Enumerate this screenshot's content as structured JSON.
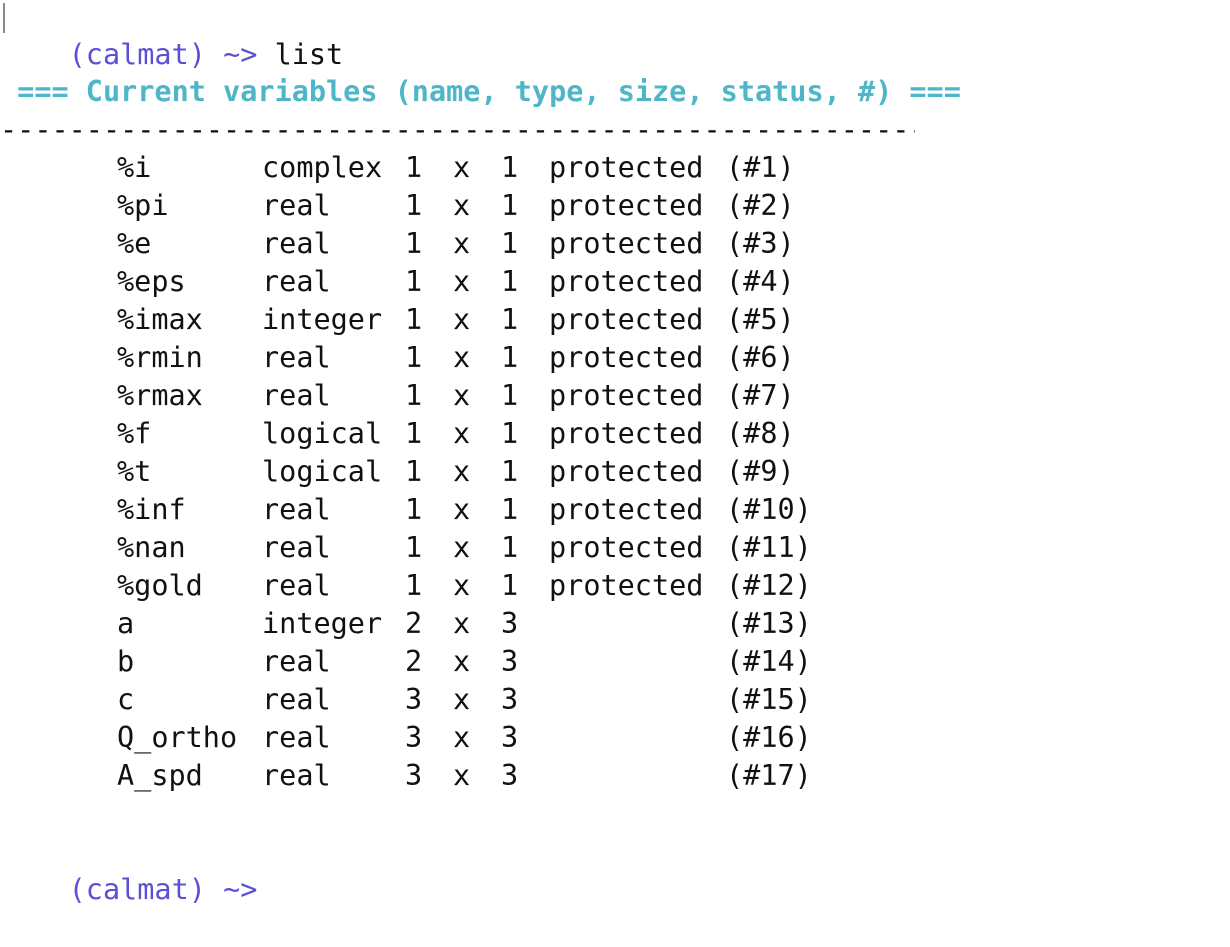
{
  "terminal": {
    "prompt": "(calmat) ~>",
    "command": "list",
    "header": " === Current variables (name, type, size, status, #) ===",
    "separator": "----------------------------------------------------------",
    "size_sep": "x",
    "final_prompt": "(calmat) ~>"
  },
  "variables": [
    {
      "name": "%i",
      "type": "complex",
      "rows": "1",
      "cols": "1",
      "status": "protected",
      "index": "(#1)"
    },
    {
      "name": "%pi",
      "type": "real",
      "rows": "1",
      "cols": "1",
      "status": "protected",
      "index": "(#2)"
    },
    {
      "name": "%e",
      "type": "real",
      "rows": "1",
      "cols": "1",
      "status": "protected",
      "index": "(#3)"
    },
    {
      "name": "%eps",
      "type": "real",
      "rows": "1",
      "cols": "1",
      "status": "protected",
      "index": "(#4)"
    },
    {
      "name": "%imax",
      "type": "integer",
      "rows": "1",
      "cols": "1",
      "status": "protected",
      "index": "(#5)"
    },
    {
      "name": "%rmin",
      "type": "real",
      "rows": "1",
      "cols": "1",
      "status": "protected",
      "index": "(#6)"
    },
    {
      "name": "%rmax",
      "type": "real",
      "rows": "1",
      "cols": "1",
      "status": "protected",
      "index": "(#7)"
    },
    {
      "name": "%f",
      "type": "logical",
      "rows": "1",
      "cols": "1",
      "status": "protected",
      "index": "(#8)"
    },
    {
      "name": "%t",
      "type": "logical",
      "rows": "1",
      "cols": "1",
      "status": "protected",
      "index": "(#9)"
    },
    {
      "name": "%inf",
      "type": "real",
      "rows": "1",
      "cols": "1",
      "status": "protected",
      "index": "(#10)"
    },
    {
      "name": "%nan",
      "type": "real",
      "rows": "1",
      "cols": "1",
      "status": "protected",
      "index": "(#11)"
    },
    {
      "name": "%gold",
      "type": "real",
      "rows": "1",
      "cols": "1",
      "status": "protected",
      "index": "(#12)"
    },
    {
      "name": "a",
      "type": "integer",
      "rows": "2",
      "cols": "3",
      "status": "",
      "index": "(#13)"
    },
    {
      "name": "b",
      "type": "real",
      "rows": "2",
      "cols": "3",
      "status": "",
      "index": "(#14)"
    },
    {
      "name": "c",
      "type": "real",
      "rows": "3",
      "cols": "3",
      "status": "",
      "index": "(#15)"
    },
    {
      "name": "Q_ortho",
      "type": "real",
      "rows": "3",
      "cols": "3",
      "status": "",
      "index": "(#16)"
    },
    {
      "name": "A_spd",
      "type": "real",
      "rows": "3",
      "cols": "3",
      "status": "",
      "index": "(#17)"
    }
  ],
  "colors": {
    "prompt": "#5b4fd6",
    "header": "#4fb5c8",
    "text": "#111111",
    "background": "#ffffff"
  }
}
